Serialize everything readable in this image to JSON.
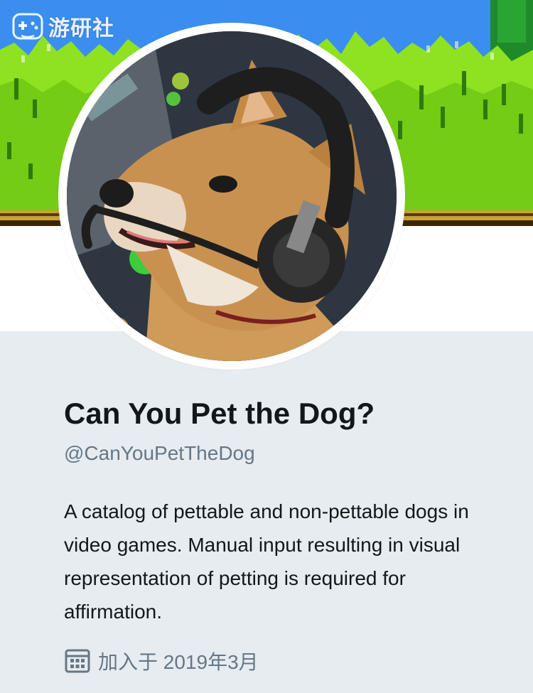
{
  "watermark": {
    "text": "游研社",
    "icon": "gamepad-icon"
  },
  "profile": {
    "display_name": "Can You Pet the Dog?",
    "handle": "@CanYouPetTheDog",
    "bio": "A catalog of pettable and non-pettable dogs in video games. Manual input resulting in visual representation of petting is required for affirmation.",
    "joined_icon": "calendar-icon",
    "joined_text": "加入于 2019年3月"
  },
  "colors": {
    "banner_sky": "#3a8ef0",
    "grass": "#79d419",
    "profile_bg": "#e6ecf0",
    "name_text": "#14171a",
    "secondary_text": "#657786"
  }
}
